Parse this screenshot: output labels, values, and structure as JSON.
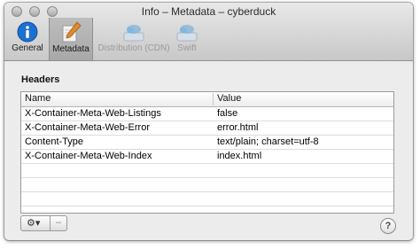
{
  "window": {
    "title": "Info – Metadata – cyberduck"
  },
  "toolbar": {
    "items": [
      {
        "label": "General"
      },
      {
        "label": "Metadata"
      },
      {
        "label": "Distribution (CDN)"
      },
      {
        "label": "Swift"
      }
    ]
  },
  "headers": {
    "section_label": "Headers",
    "columns": {
      "name": "Name",
      "value": "Value"
    },
    "rows": [
      {
        "name": "X-Container-Meta-Web-Listings",
        "value": "false"
      },
      {
        "name": "X-Container-Meta-Web-Error",
        "value": "error.html"
      },
      {
        "name": "Content-Type",
        "value": "text/plain; charset=utf-8"
      },
      {
        "name": "X-Container-Meta-Web-Index",
        "value": "index.html"
      }
    ]
  },
  "actions": {
    "gear_symbol": "⚙▾",
    "remove_symbol": "–",
    "help_symbol": "?"
  },
  "colors": {
    "info_icon": "#1d6fd1",
    "cdn_icon": "#7fb3dc"
  }
}
